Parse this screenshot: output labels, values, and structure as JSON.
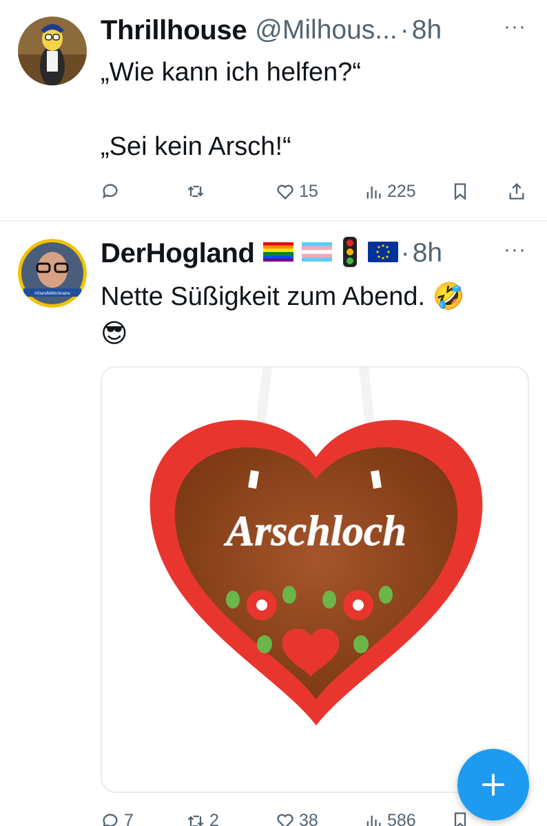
{
  "tweets": [
    {
      "name": "Thrillhouse",
      "handle": "@Milhous...",
      "dot": "·",
      "time": "8h",
      "more": "···",
      "text": "„Wie kann ich helfen?“\n\n„Sei kein Arsch!“",
      "actions": {
        "reply": "",
        "retweet": "",
        "like": "15",
        "views": "225"
      }
    },
    {
      "name": "DerHogland",
      "dot": "·",
      "time": "8h",
      "more": "···",
      "badges": [
        "rainbow-flag",
        "trans-flag",
        "traffic-light",
        "eu-flag"
      ],
      "text": "Nette Süßigkeit zum Abend. 🤣\n😎",
      "avatar_banner": "#StandWithUkraine",
      "image": {
        "description_text": "Arschloch"
      },
      "actions": {
        "reply": "7",
        "retweet": "2",
        "like": "38",
        "views": "586"
      }
    }
  ],
  "compose_button": {
    "label": "+"
  },
  "colors": {
    "accent": "#1d9bf0",
    "secondary_text": "#536471",
    "primary_text": "#0f1419"
  }
}
